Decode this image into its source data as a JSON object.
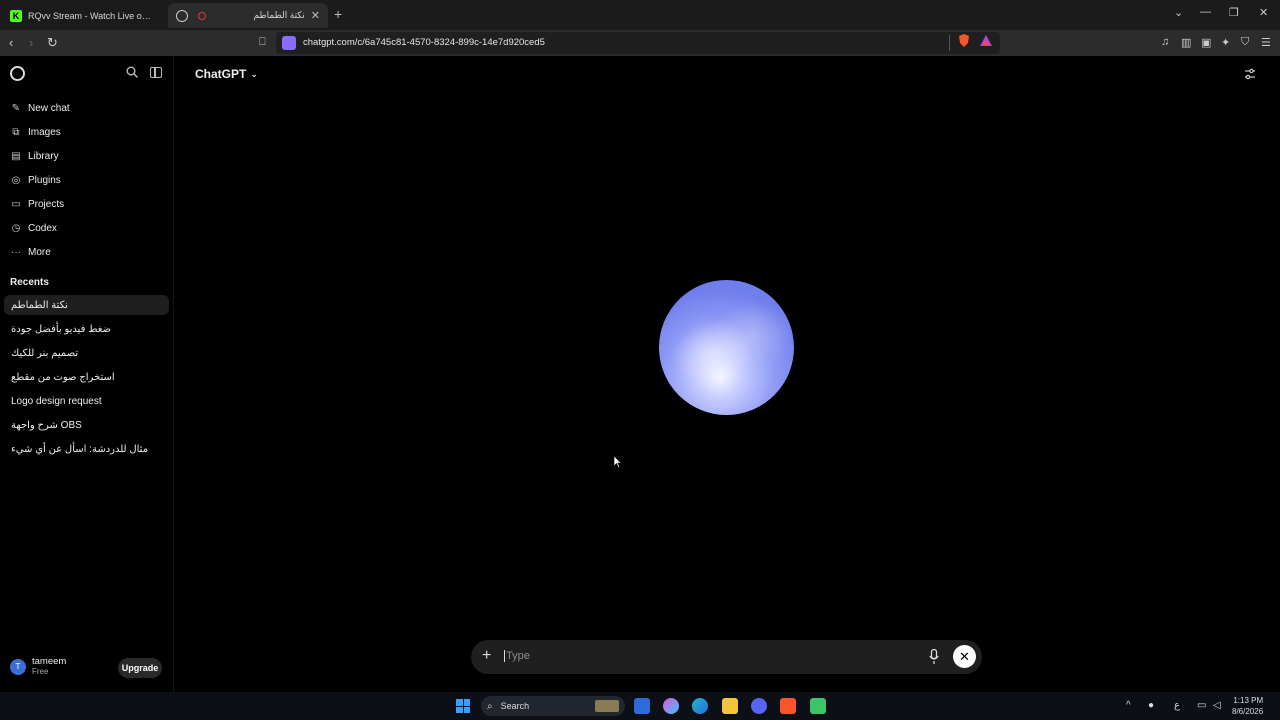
{
  "browser": {
    "tabs": [
      {
        "title": "RQvv Stream - Watch Live on Kick",
        "favicon": "kick-icon"
      },
      {
        "title": "نكتة الطماطم",
        "favicon": "chatgpt-icon"
      }
    ],
    "url": "chatgpt.com/c/6a745c81-4570-8324-899c-14e7d920ced5"
  },
  "sidebar": {
    "items": [
      {
        "label": "New chat",
        "icon": "pencil-icon"
      },
      {
        "label": "Images",
        "icon": "images-icon"
      },
      {
        "label": "Library",
        "icon": "library-icon"
      },
      {
        "label": "Plugins",
        "icon": "plugins-icon"
      },
      {
        "label": "Projects",
        "icon": "folder-icon"
      },
      {
        "label": "Codex",
        "icon": "codex-icon"
      },
      {
        "label": "More",
        "icon": "more-icon"
      }
    ],
    "recents_label": "Recents",
    "recents": [
      "نكتة الطماطم",
      "ضغط فيديو بأفضل جودة",
      "تصميم بنر للكيك",
      "استخراج صوت من مقطع",
      "Logo design request",
      "شرح واجهة OBS",
      "مثال للدردشة: اسأل عن أي شيء"
    ],
    "user": {
      "initial": "T",
      "name": "tameem",
      "plan": "Free"
    },
    "upgrade_label": "Upgrade"
  },
  "main": {
    "model_label": "ChatGPT",
    "composer_placeholder": "Type"
  },
  "taskbar": {
    "search_label": "Search",
    "time": "1:13 PM",
    "date": "8/6/2026",
    "lang": "ع"
  },
  "colors": {
    "orb": "#7a86f0",
    "background": "#000000",
    "composer": "#1f1f1f"
  }
}
